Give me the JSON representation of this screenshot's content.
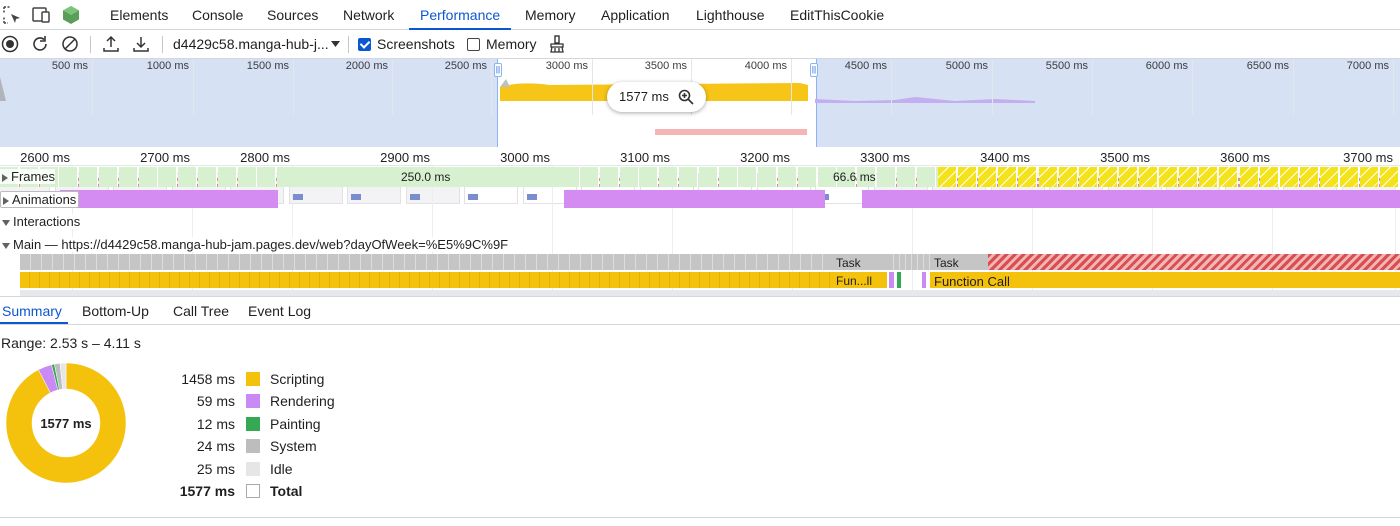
{
  "tabs": [
    "Elements",
    "Console",
    "Sources",
    "Network",
    "Performance",
    "Memory",
    "Application",
    "Lighthouse",
    "EditThisCookie"
  ],
  "active_tab": "Performance",
  "toolbar": {
    "target": "d4429c58.manga-hub-j...",
    "screenshots_label": "Screenshots",
    "screenshots_checked": true,
    "memory_label": "Memory",
    "memory_checked": false
  },
  "overview": {
    "ticks": [
      "500 ms",
      "1000 ms",
      "1500 ms",
      "2000 ms",
      "2500 ms",
      "3000 ms",
      "3500 ms",
      "4000 ms",
      "4500 ms",
      "5000 ms",
      "5500 ms",
      "6000 ms",
      "6500 ms",
      "7000 ms"
    ],
    "selection_duration": "1577 ms"
  },
  "ruler": [
    "2600 ms",
    "2700 ms",
    "2800 ms",
    "2900 ms",
    "3000 ms",
    "3100 ms",
    "3200 ms",
    "3300 ms",
    "3400 ms",
    "3500 ms",
    "3600 ms",
    "3700 ms"
  ],
  "tracks": {
    "frames_label": "Frames",
    "frame_time_1": "250.0 ms",
    "frame_time_2": "66.6 ms",
    "animations_label": "Animations",
    "interactions_label": "Interactions",
    "main_label": "Main — https://d4429c58.manga-hub-jam.pages.dev/web?dayOfWeek=%E5%9C%9F",
    "task_label_1": "Task",
    "task_label_2": "Task",
    "func_label_1": "Fun...ll",
    "func_label_2": "Function Call"
  },
  "summary_tabs": [
    "Summary",
    "Bottom-Up",
    "Call Tree",
    "Event Log"
  ],
  "summary": {
    "range": "Range: 2.53 s – 4.11 s",
    "total_center": "1577 ms",
    "rows": [
      {
        "value": "1458 ms",
        "label": "Scripting",
        "color": "#f4c20d"
      },
      {
        "value": "59 ms",
        "label": "Rendering",
        "color": "#c98af5"
      },
      {
        "value": "12 ms",
        "label": "Painting",
        "color": "#34a853"
      },
      {
        "value": "24 ms",
        "label": "System",
        "color": "#bdbdbd"
      },
      {
        "value": "25 ms",
        "label": "Idle",
        "color": "#e6e6e6"
      }
    ],
    "total": {
      "value": "1577 ms",
      "label": "Total"
    }
  },
  "icons": [
    "select-element-icon",
    "device-toggle-icon",
    "extension-cube-icon",
    "record-icon",
    "reload-icon",
    "clear-icon",
    "upload-icon",
    "download-icon",
    "dropdown-arrow-icon",
    "gc-broom-icon",
    "zoom-icon"
  ]
}
